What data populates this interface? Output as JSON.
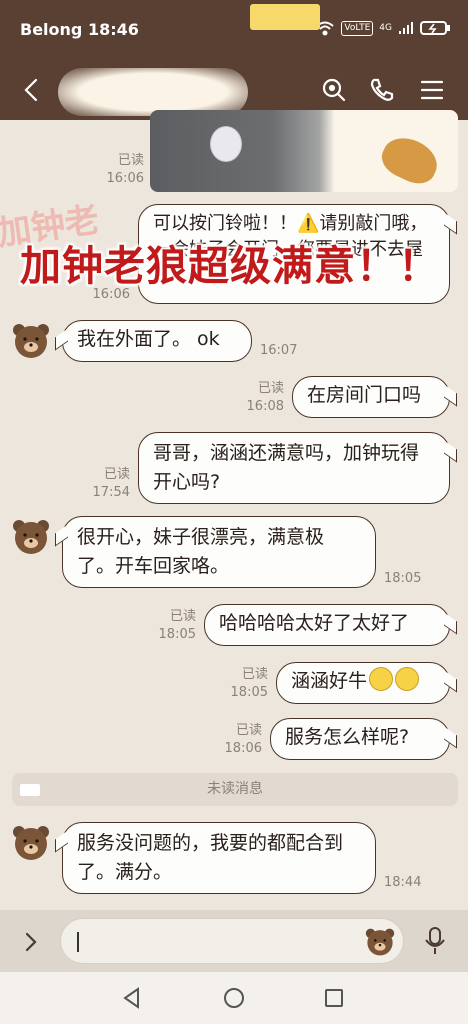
{
  "status_bar": {
    "carrier_time": "Belong 18:46",
    "volte": "VoLTE",
    "network": "4G"
  },
  "header": {
    "back_icon": "back-arrow-icon",
    "search_icon": "search-icon",
    "call_icon": "phone-icon",
    "menu_icon": "menu-icon"
  },
  "overlay": {
    "banner": "加钟老狼超级满意！！"
  },
  "messages": [
    {
      "status": "已读",
      "time": "16:06"
    },
    {
      "text": "可以按门铃啦！！⚠️请别敲门哦，一会妹子会开门，您要是进不去屋",
      "status": "",
      "time": "16:06"
    },
    {
      "text": "我在外面了。 ok",
      "time": "16:07"
    },
    {
      "text": "在房间门口吗",
      "status": "已读",
      "time": "16:08"
    },
    {
      "text": "哥哥，涵涵还满意吗，加钟玩得开心吗?",
      "status": "已读",
      "time": "17:54"
    },
    {
      "text": "很开心，妹子很漂亮，满意极了。开车回家咯。",
      "time": "18:05"
    },
    {
      "text": "哈哈哈哈太好了太好了",
      "status": "已读",
      "time": "18:05"
    },
    {
      "text": "涵涵好牛",
      "status": "已读",
      "time": "18:05"
    },
    {
      "text": "服务怎么样呢?",
      "status": "已读",
      "time": "18:06"
    },
    {
      "text": "服务没问题的，我要的都配合到了。满分。",
      "time": "18:44"
    }
  ],
  "unread_divider": "未读消息",
  "input": {
    "expand_icon": "chevron-right-icon",
    "sticker_icon": "bear-sticker-icon",
    "voice_icon": "microphone-icon"
  },
  "nav": {
    "back": "triangle-back-icon",
    "home": "circle-home-icon",
    "recent": "square-recent-icon"
  },
  "colors": {
    "header": "#5a4033",
    "chat_bg": "#ece6dd",
    "bubble_border": "#4b3427",
    "banner_text": "#c01a1a"
  }
}
